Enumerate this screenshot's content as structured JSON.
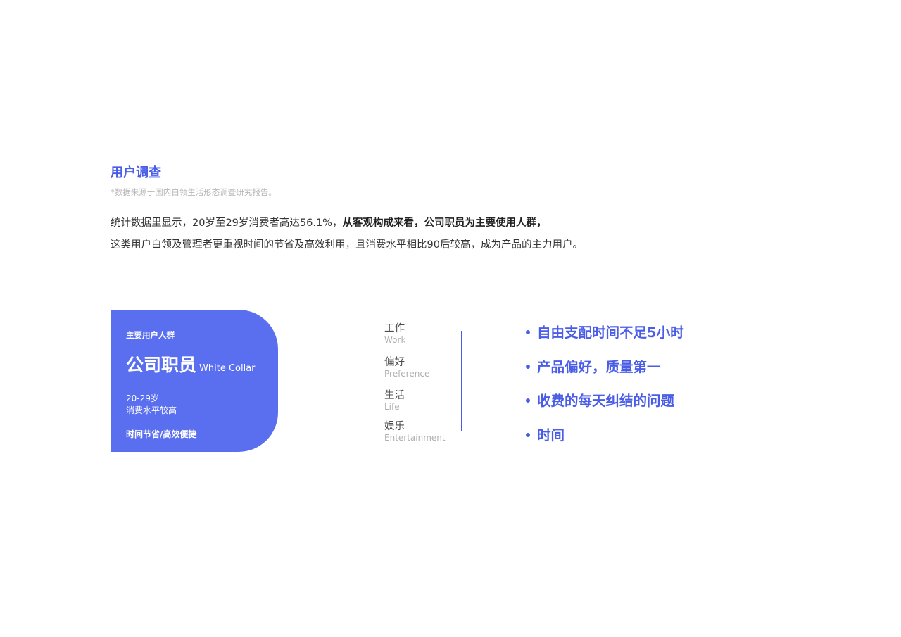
{
  "header": {
    "title": "用户调查",
    "source_note": "*数据来源于国内白领生活形态调查研究报告。"
  },
  "intro": {
    "line1_normal": "统计数据里显示，20岁至29岁消费者高达56.1%，",
    "line1_bold": "从客观构成来看，公司职员为主要使用人群，",
    "line2": "这类用户白领及管理者更重视时间的节省及高效利用，且消费水平相比90后较高，成为产品的主力用户。"
  },
  "card": {
    "label": "主要用户人群",
    "title": "公司职员",
    "title_en": "White Collar",
    "age": "20-29岁",
    "consumption": "消费水平较高",
    "feature": "时间节省/高效便捷",
    "color": "#5a6ff0"
  },
  "categories": [
    {
      "zh": "工作",
      "en": "Work"
    },
    {
      "zh": "偏好",
      "en": "Preference"
    },
    {
      "zh": "生活",
      "en": "Life"
    },
    {
      "zh": "娱乐",
      "en": "Entertainment"
    }
  ],
  "bullets": [
    "自由支配时间不足5小时",
    "产品偏好，质量第一",
    "收费的每天纠结的问题",
    "时间"
  ],
  "colors": {
    "accent": "#4a5de6",
    "text": "#333333",
    "muted": "#b0b0b0"
  }
}
